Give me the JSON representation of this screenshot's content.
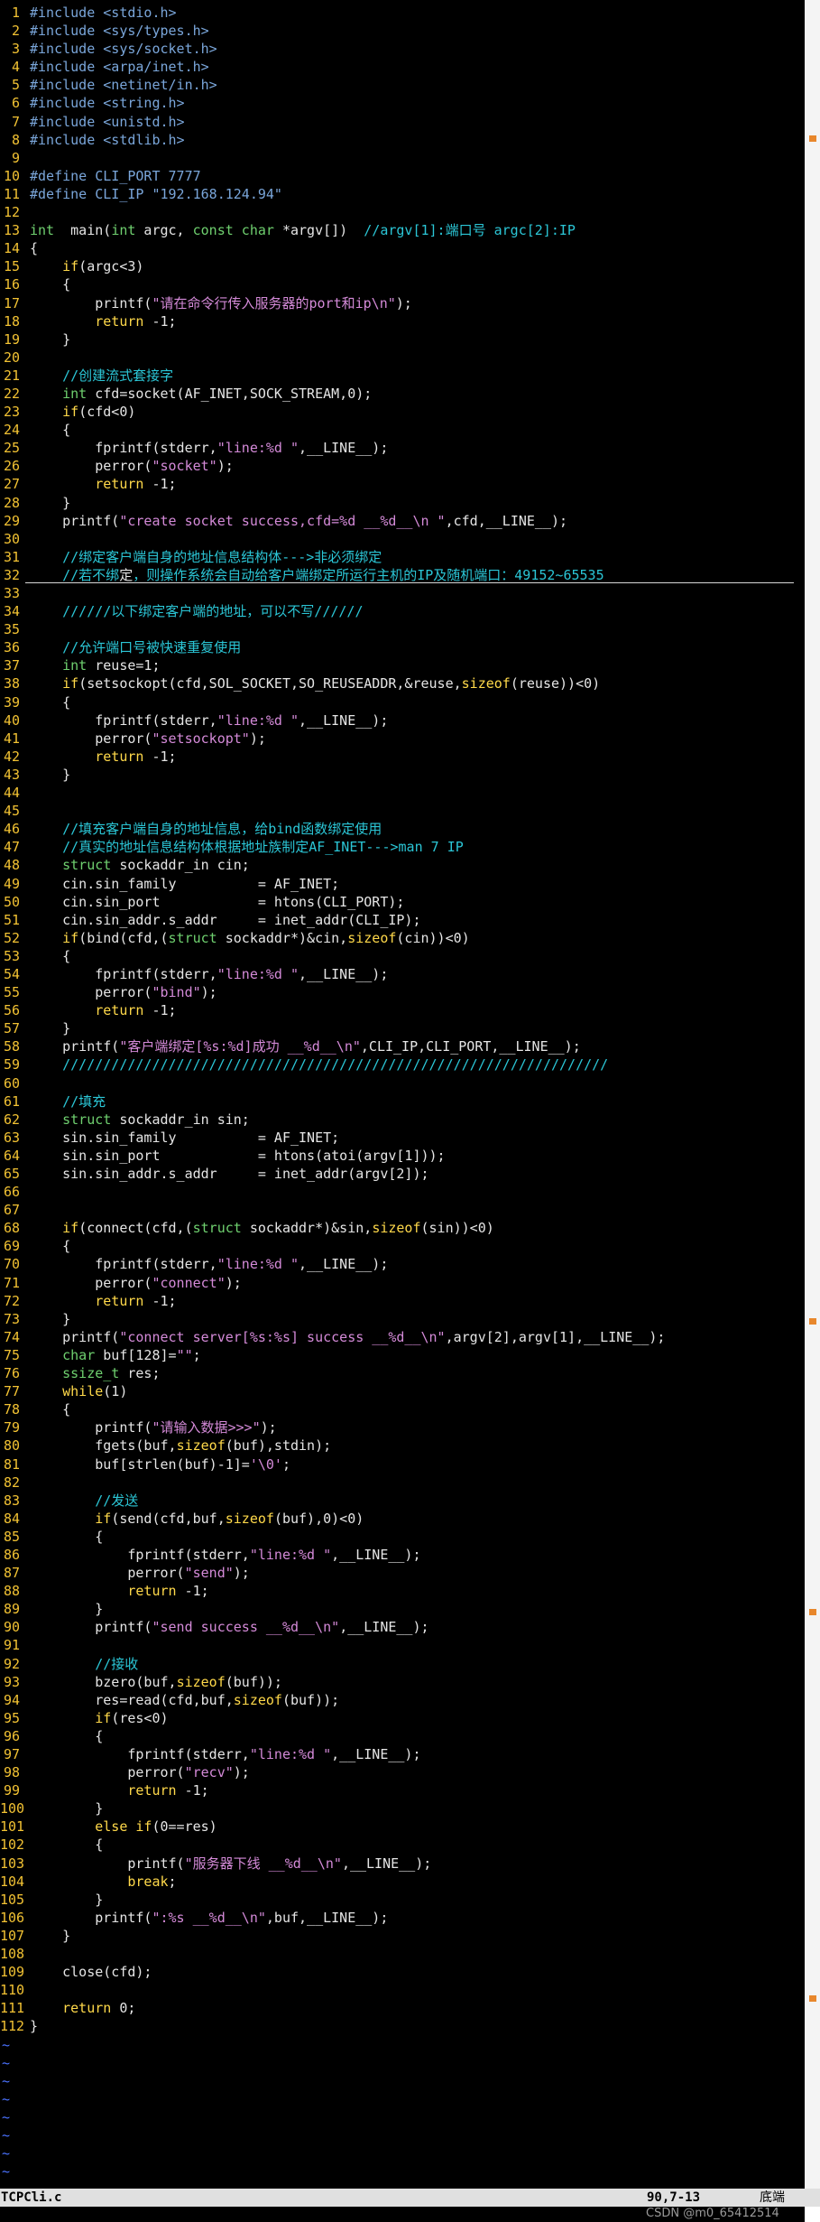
{
  "editor": {
    "file_name": "TCPCli.c",
    "cursor_position": "90,7-13",
    "scroll_label": "底端",
    "cursor_line": 32,
    "colors": {
      "background": "#000000",
      "line_number": "#f2c233",
      "preprocessor": "#7aa6da",
      "string": "#d48ad8",
      "comment": "#2bc6d6",
      "keyword": "#ffd94a",
      "type": "#6fd06f",
      "text": "#e5e5e5",
      "tilde": "#4a72ff",
      "statusbar": "#e0e0e0"
    },
    "lines": [
      [
        [
          "pp",
          "#include <stdio.h>"
        ]
      ],
      [
        [
          "pp",
          "#include <sys/types.h>"
        ]
      ],
      [
        [
          "pp",
          "#include <sys/socket.h>"
        ]
      ],
      [
        [
          "pp",
          "#include <arpa/inet.h>"
        ]
      ],
      [
        [
          "pp",
          "#include <netinet/in.h>"
        ]
      ],
      [
        [
          "pp",
          "#include <string.h>"
        ]
      ],
      [
        [
          "pp",
          "#include <unistd.h>"
        ]
      ],
      [
        [
          "pp",
          "#include <stdlib.h>"
        ]
      ],
      [],
      [
        [
          "pp",
          "#define CLI_PORT 7777"
        ]
      ],
      [
        [
          "pp",
          "#define CLI_IP \"192.168.124.94\""
        ]
      ],
      [],
      [
        [
          "ty",
          "int"
        ],
        [
          "",
          "  main("
        ],
        [
          "ty",
          "int"
        ],
        [
          "",
          " argc, "
        ],
        [
          "ty",
          "const char"
        ],
        [
          "",
          " *argv[])  "
        ],
        [
          "cm",
          "//argv[1]:端口号 argc[2]:IP"
        ]
      ],
      [
        [
          "",
          "{"
        ]
      ],
      [
        [
          "",
          "    "
        ],
        [
          "kw",
          "if"
        ],
        [
          "",
          "(argc<3)"
        ]
      ],
      [
        [
          "",
          "    {"
        ]
      ],
      [
        [
          "",
          "        printf("
        ],
        [
          "str",
          "\"请在命令行传入服务器的port和ip\\n\""
        ],
        [
          "",
          ");"
        ]
      ],
      [
        [
          "",
          "        "
        ],
        [
          "kw",
          "return"
        ],
        [
          "",
          " -1;"
        ]
      ],
      [
        [
          "",
          "    }"
        ]
      ],
      [],
      [
        [
          "",
          "    "
        ],
        [
          "cm",
          "//创建流式套接字"
        ]
      ],
      [
        [
          "",
          "    "
        ],
        [
          "ty",
          "int"
        ],
        [
          "",
          " cfd=socket(AF_INET,SOCK_STREAM,0);"
        ]
      ],
      [
        [
          "",
          "    "
        ],
        [
          "kw",
          "if"
        ],
        [
          "",
          "(cfd<0)"
        ]
      ],
      [
        [
          "",
          "    {"
        ]
      ],
      [
        [
          "",
          "        fprintf(stderr,"
        ],
        [
          "str",
          "\"line:%d \""
        ],
        [
          "",
          ",__LINE__);"
        ]
      ],
      [
        [
          "",
          "        perror("
        ],
        [
          "str",
          "\"socket\""
        ],
        [
          "",
          ");"
        ]
      ],
      [
        [
          "",
          "        "
        ],
        [
          "kw",
          "return"
        ],
        [
          "",
          " -1;"
        ]
      ],
      [
        [
          "",
          "    }"
        ]
      ],
      [
        [
          "",
          "    printf("
        ],
        [
          "str",
          "\"create socket success,cfd=%d __%d__\\n \""
        ],
        [
          "",
          ",cfd,__LINE__);"
        ]
      ],
      [],
      [
        [
          "",
          "    "
        ],
        [
          "cm",
          "//绑定客户端自身的地址信息结构体--->非必须绑定"
        ]
      ],
      [
        [
          "",
          "    "
        ],
        [
          "cm",
          "//若不绑"
        ],
        [
          "bk",
          "定"
        ],
        [
          "cm",
          "，则操作系统会自动给客户端绑定所运行主机的IP及随机端口：49152~65535"
        ]
      ],
      [],
      [
        [
          "",
          "    "
        ],
        [
          "cm",
          "//////以下绑定客户端的地址，可以不写//////"
        ]
      ],
      [],
      [
        [
          "",
          "    "
        ],
        [
          "cm",
          "//允许端口号被快速重复使用"
        ]
      ],
      [
        [
          "",
          "    "
        ],
        [
          "ty",
          "int"
        ],
        [
          "",
          " reuse=1;"
        ]
      ],
      [
        [
          "",
          "    "
        ],
        [
          "kw",
          "if"
        ],
        [
          "",
          "(setsockopt(cfd,SOL_SOCKET,SO_REUSEADDR,&reuse,"
        ],
        [
          "kw",
          "sizeof"
        ],
        [
          "",
          "(reuse))<0)"
        ]
      ],
      [
        [
          "",
          "    {"
        ]
      ],
      [
        [
          "",
          "        fprintf(stderr,"
        ],
        [
          "str",
          "\"line:%d \""
        ],
        [
          "",
          ",__LINE__);"
        ]
      ],
      [
        [
          "",
          "        perror("
        ],
        [
          "str",
          "\"setsockopt\""
        ],
        [
          "",
          ");"
        ]
      ],
      [
        [
          "",
          "        "
        ],
        [
          "kw",
          "return"
        ],
        [
          "",
          " -1;"
        ]
      ],
      [
        [
          "",
          "    }"
        ]
      ],
      [],
      [],
      [
        [
          "",
          "    "
        ],
        [
          "cm",
          "//填充客户端自身的地址信息，给bind函数绑定使用"
        ]
      ],
      [
        [
          "",
          "    "
        ],
        [
          "cm",
          "//真实的地址信息结构体根据地址族制定AF_INET--->man 7 IP"
        ]
      ],
      [
        [
          "",
          "    "
        ],
        [
          "ty",
          "struct"
        ],
        [
          "",
          " sockaddr_in cin;"
        ]
      ],
      [
        [
          "",
          "    cin.sin_family          = AF_INET;"
        ]
      ],
      [
        [
          "",
          "    cin.sin_port            = htons(CLI_PORT);"
        ]
      ],
      [
        [
          "",
          "    cin.sin_addr.s_addr     = inet_addr(CLI_IP);"
        ]
      ],
      [
        [
          "",
          "    "
        ],
        [
          "kw",
          "if"
        ],
        [
          "",
          "(bind(cfd,("
        ],
        [
          "ty",
          "struct"
        ],
        [
          "",
          " sockaddr*)&cin,"
        ],
        [
          "kw",
          "sizeof"
        ],
        [
          "",
          "(cin))<0)"
        ]
      ],
      [
        [
          "",
          "    {"
        ]
      ],
      [
        [
          "",
          "        fprintf(stderr,"
        ],
        [
          "str",
          "\"line:%d \""
        ],
        [
          "",
          ",__LINE__);"
        ]
      ],
      [
        [
          "",
          "        perror("
        ],
        [
          "str",
          "\"bind\""
        ],
        [
          "",
          ");"
        ]
      ],
      [
        [
          "",
          "        "
        ],
        [
          "kw",
          "return"
        ],
        [
          "",
          " -1;"
        ]
      ],
      [
        [
          "",
          "    }"
        ]
      ],
      [
        [
          "",
          "    printf("
        ],
        [
          "str",
          "\"客户端绑定[%s:%d]成功 __%d__\\n\""
        ],
        [
          "",
          ",CLI_IP,CLI_PORT,__LINE__);"
        ]
      ],
      [
        [
          "",
          "    "
        ],
        [
          "cm",
          "///////////////////////////////////////////////////////////////////"
        ]
      ],
      [],
      [
        [
          "",
          "    "
        ],
        [
          "cm",
          "//填充"
        ]
      ],
      [
        [
          "",
          "    "
        ],
        [
          "ty",
          "struct"
        ],
        [
          "",
          " sockaddr_in sin;"
        ]
      ],
      [
        [
          "",
          "    sin.sin_family          = AF_INET;"
        ]
      ],
      [
        [
          "",
          "    sin.sin_port            = htons(atoi(argv[1]));"
        ]
      ],
      [
        [
          "",
          "    sin.sin_addr.s_addr     = inet_addr(argv[2]);"
        ]
      ],
      [],
      [],
      [
        [
          "",
          "    "
        ],
        [
          "kw",
          "if"
        ],
        [
          "",
          "(connect(cfd,("
        ],
        [
          "ty",
          "struct"
        ],
        [
          "",
          " sockaddr*)&sin,"
        ],
        [
          "kw",
          "sizeof"
        ],
        [
          "",
          "(sin))<0)"
        ]
      ],
      [
        [
          "",
          "    {"
        ]
      ],
      [
        [
          "",
          "        fprintf(stderr,"
        ],
        [
          "str",
          "\"line:%d \""
        ],
        [
          "",
          ",__LINE__);"
        ]
      ],
      [
        [
          "",
          "        perror("
        ],
        [
          "str",
          "\"connect\""
        ],
        [
          "",
          ");"
        ]
      ],
      [
        [
          "",
          "        "
        ],
        [
          "kw",
          "return"
        ],
        [
          "",
          " -1;"
        ]
      ],
      [
        [
          "",
          "    }"
        ]
      ],
      [
        [
          "",
          "    printf("
        ],
        [
          "str",
          "\"connect server[%s:%s] success __%d__\\n\""
        ],
        [
          "",
          ",argv[2],argv[1],__LINE__);"
        ]
      ],
      [
        [
          "",
          "    "
        ],
        [
          "ty",
          "char"
        ],
        [
          "",
          " buf[128]="
        ],
        [
          "str",
          "\"\""
        ],
        [
          "",
          ";"
        ]
      ],
      [
        [
          "",
          "    "
        ],
        [
          "ty",
          "ssize_t"
        ],
        [
          "",
          " res;"
        ]
      ],
      [
        [
          "",
          "    "
        ],
        [
          "kw",
          "while"
        ],
        [
          "",
          "(1)"
        ]
      ],
      [
        [
          "",
          "    {"
        ]
      ],
      [
        [
          "",
          "        printf("
        ],
        [
          "str",
          "\"请输入数据>>>\""
        ],
        [
          "",
          ");"
        ]
      ],
      [
        [
          "",
          "        fgets(buf,"
        ],
        [
          "kw",
          "sizeof"
        ],
        [
          "",
          "(buf),stdin);"
        ]
      ],
      [
        [
          "",
          "        buf[strlen(buf)-1]="
        ],
        [
          "str",
          "'\\0'"
        ],
        [
          "",
          ";"
        ]
      ],
      [],
      [
        [
          "",
          "        "
        ],
        [
          "cm",
          "//发送"
        ]
      ],
      [
        [
          "",
          "        "
        ],
        [
          "kw",
          "if"
        ],
        [
          "",
          "(send(cfd,buf,"
        ],
        [
          "kw",
          "sizeof"
        ],
        [
          "",
          "(buf),0)<0)"
        ]
      ],
      [
        [
          "",
          "        {"
        ]
      ],
      [
        [
          "",
          "            fprintf(stderr,"
        ],
        [
          "str",
          "\"line:%d \""
        ],
        [
          "",
          ",__LINE__);"
        ]
      ],
      [
        [
          "",
          "            perror("
        ],
        [
          "str",
          "\"send\""
        ],
        [
          "",
          ");"
        ]
      ],
      [
        [
          "",
          "            "
        ],
        [
          "kw",
          "return"
        ],
        [
          "",
          " -1;"
        ]
      ],
      [
        [
          "",
          "        }"
        ]
      ],
      [
        [
          "",
          "        printf("
        ],
        [
          "str",
          "\"send success __%d__\\n\""
        ],
        [
          "",
          ",__LINE__);"
        ]
      ],
      [],
      [
        [
          "",
          "        "
        ],
        [
          "cm",
          "//接收"
        ]
      ],
      [
        [
          "",
          "        bzero(buf,"
        ],
        [
          "kw",
          "sizeof"
        ],
        [
          "",
          "(buf));"
        ]
      ],
      [
        [
          "",
          "        res=read(cfd,buf,"
        ],
        [
          "kw",
          "sizeof"
        ],
        [
          "",
          "(buf));"
        ]
      ],
      [
        [
          "",
          "        "
        ],
        [
          "kw",
          "if"
        ],
        [
          "",
          "(res<0)"
        ]
      ],
      [
        [
          "",
          "        {"
        ]
      ],
      [
        [
          "",
          "            fprintf(stderr,"
        ],
        [
          "str",
          "\"line:%d \""
        ],
        [
          "",
          ",__LINE__);"
        ]
      ],
      [
        [
          "",
          "            perror("
        ],
        [
          "str",
          "\"recv\""
        ],
        [
          "",
          ");"
        ]
      ],
      [
        [
          "",
          "            "
        ],
        [
          "kw",
          "return"
        ],
        [
          "",
          " -1;"
        ]
      ],
      [
        [
          "",
          "        }"
        ]
      ],
      [
        [
          "",
          "        "
        ],
        [
          "kw",
          "else if"
        ],
        [
          "",
          "(0==res)"
        ]
      ],
      [
        [
          "",
          "        {"
        ]
      ],
      [
        [
          "",
          "            printf("
        ],
        [
          "str",
          "\"服务器下线 __%d__\\n\""
        ],
        [
          "",
          ",__LINE__);"
        ]
      ],
      [
        [
          "",
          "            "
        ],
        [
          "kw",
          "break"
        ],
        [
          "",
          ";"
        ]
      ],
      [
        [
          "",
          "        }"
        ]
      ],
      [
        [
          "",
          "        printf("
        ],
        [
          "str",
          "\":%s __%d__\\n\""
        ],
        [
          "",
          ",buf,__LINE__);"
        ]
      ],
      [
        [
          "",
          "    }"
        ]
      ],
      [],
      [
        [
          "",
          "    close(cfd);"
        ]
      ],
      [],
      [
        [
          "",
          "    "
        ],
        [
          "kw",
          "return"
        ],
        [
          "",
          " 0;"
        ]
      ],
      [
        [
          "",
          "}"
        ]
      ]
    ],
    "tilde_char": "~",
    "tilde_count": 9
  },
  "watermark": "CSDN @m0_65412514"
}
